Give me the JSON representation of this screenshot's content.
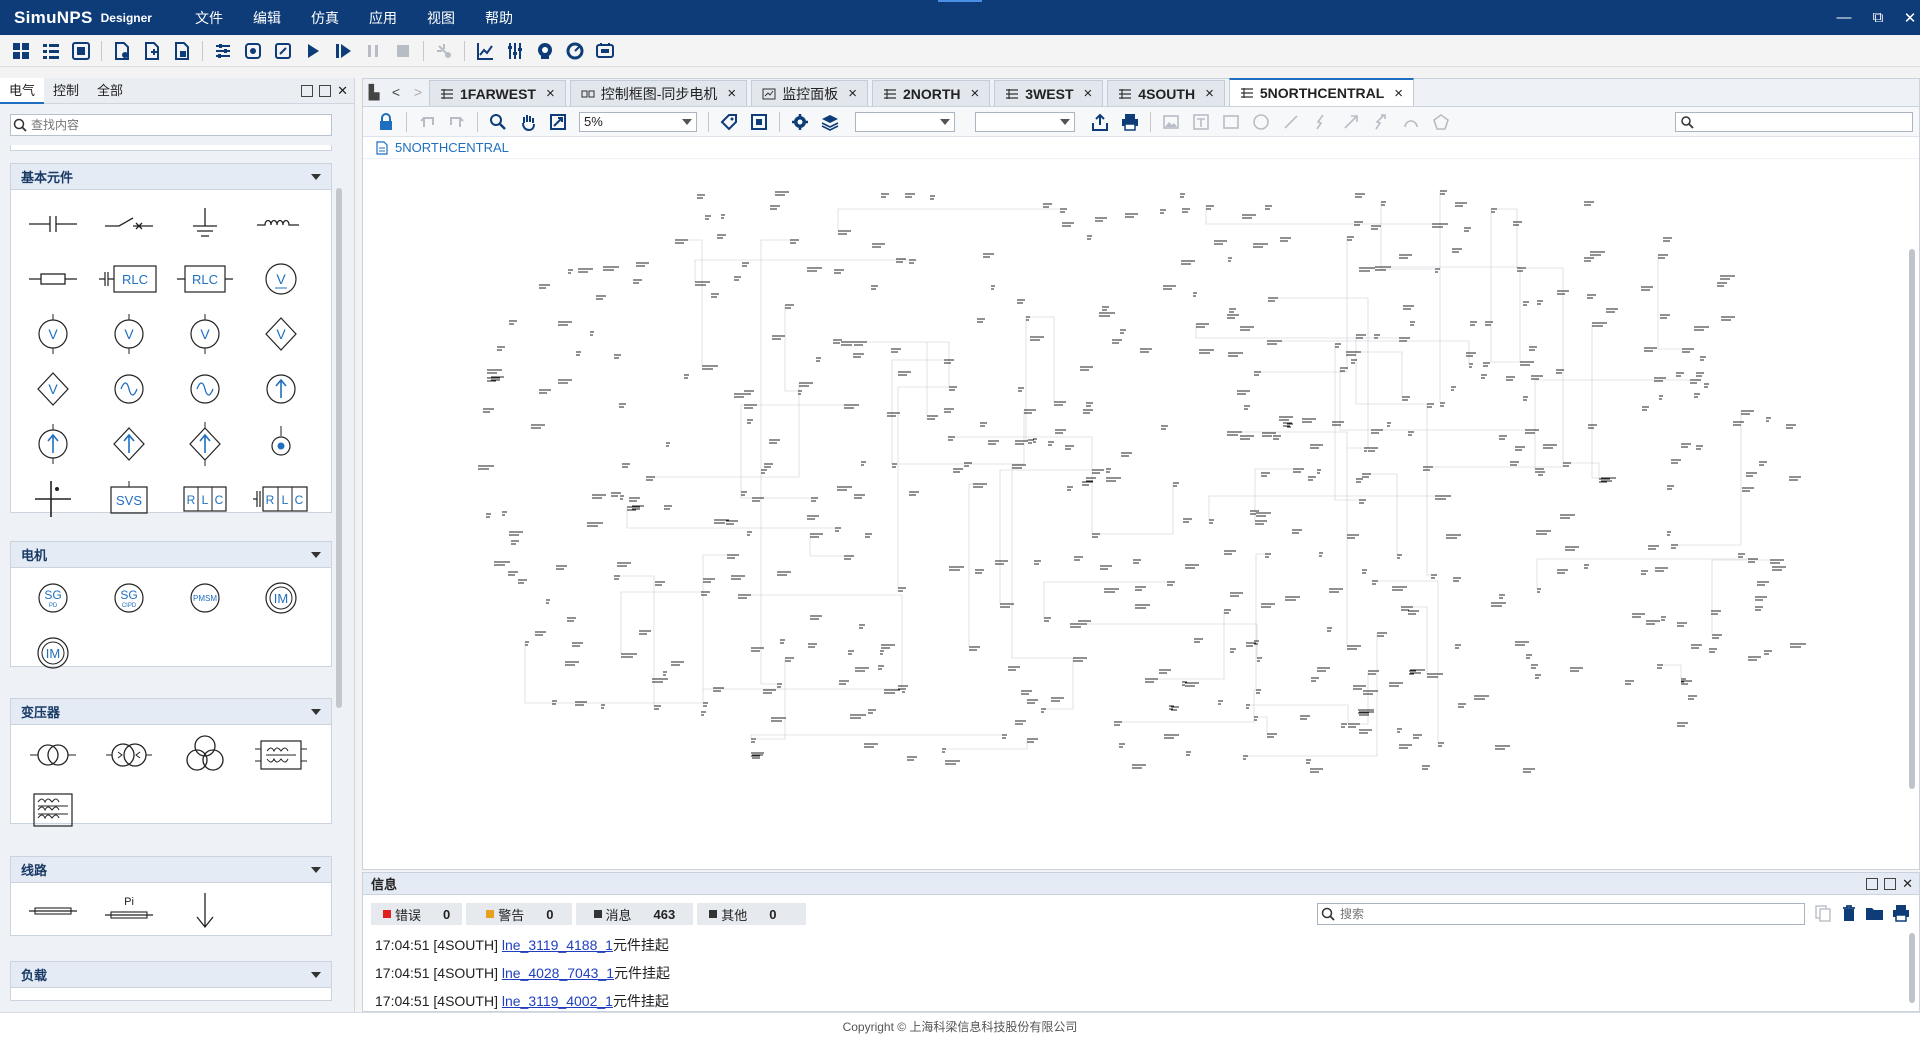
{
  "app": {
    "title": "SimuNPS",
    "subtitle": "Designer"
  },
  "menu": [
    "文件",
    "编辑",
    "仿真",
    "应用",
    "视图",
    "帮助"
  ],
  "window": {
    "minimize": "—",
    "restore": "⧉",
    "close": "✕"
  },
  "left_panel": {
    "tabs": [
      "电气",
      "控制",
      "全部"
    ],
    "search_placeholder": "查找内容",
    "sections": [
      {
        "title": "基本元件",
        "items": [
          "capacitor-icon",
          "switch-icon",
          "ground-icon",
          "inductor-icon",
          "resistor-icon",
          "rlc-branch-icon",
          "rlc-icon",
          "dc-voltage-source-icon",
          "voltage-source-icon",
          "voltage-source-alt-icon",
          "voltage-source-controlled-icon",
          "voltage-source-diamond-icon",
          "voltage-source-diamond-alt-icon",
          "ac-source-icon",
          "ac-source-alt-icon",
          "current-source-icon",
          "current-source-ground-icon",
          "current-source-diamond-icon",
          "current-source-diamond-alt-icon",
          "meter-point-icon",
          "bus-fault-icon",
          "svs-icon",
          "rlc-box-icon",
          "rlc-box-branch-icon"
        ],
        "labels": {
          "rlc": "RLC",
          "svs": "SVS",
          "v": "V"
        }
      },
      {
        "title": "电机",
        "items": [
          "sg-pd-icon",
          "sg-cipd-icon",
          "pmsm-icon",
          "im-icon",
          "im-alt-icon"
        ],
        "labels": {
          "sg": "SG",
          "pd": "PD",
          "cipd": "CIPD",
          "pmsm": "PMSM",
          "im": "IM"
        }
      },
      {
        "title": "变压器",
        "items": [
          "two-winding-transformer-icon",
          "transformer-phase-icon",
          "three-winding-transformer-icon",
          "transformer-box-icon",
          "transformer-box-multi-icon"
        ]
      },
      {
        "title": "线路",
        "items": [
          "line-icon",
          "pi-line-icon",
          "load-arrow-icon"
        ],
        "labels": {
          "pi": "Pi"
        }
      },
      {
        "title": "负载",
        "items": []
      }
    ]
  },
  "doc_tabs": [
    {
      "label": "1FARWEST",
      "icon": "grid-tab-icon",
      "active": false
    },
    {
      "label": "控制框图-同步电机",
      "icon": "control-tab-icon",
      "active": false
    },
    {
      "label": "监控面板",
      "icon": "monitor-tab-icon",
      "active": false
    },
    {
      "label": "2NORTH",
      "icon": "grid-tab-icon",
      "active": false
    },
    {
      "label": "3WEST",
      "icon": "grid-tab-icon",
      "active": false
    },
    {
      "label": "4SOUTH",
      "icon": "grid-tab-icon",
      "active": false
    },
    {
      "label": "5NORTHCENTRAL",
      "icon": "grid-tab-icon",
      "active": true
    }
  ],
  "tab_close": "×",
  "editor": {
    "zoom": "5%",
    "breadcrumb": "5NORTHCENTRAL"
  },
  "info_panel": {
    "title": "信息",
    "counters": [
      {
        "label": "错误",
        "count": "0",
        "color": "#e02020"
      },
      {
        "label": "警告",
        "count": "0",
        "color": "#e8a020"
      },
      {
        "label": "消息",
        "count": "463",
        "color": "#333333"
      },
      {
        "label": "其他",
        "count": "0",
        "color": "#333333"
      }
    ],
    "search_placeholder": "搜索",
    "logs": [
      {
        "time": "17:04:51",
        "source": "[4SOUTH]",
        "link": "lne_3119_4188_1",
        "msg": "元件挂起"
      },
      {
        "time": "17:04:51",
        "source": "[4SOUTH]",
        "link": "lne_4028_7043_1",
        "msg": "元件挂起"
      },
      {
        "time": "17:04:51",
        "source": "[4SOUTH]",
        "link": "lne_3119_4002_1",
        "msg": "元件挂起"
      }
    ]
  },
  "footer": "Copyright © 上海科梁信息科技股份有限公司",
  "colors": {
    "titlebar": "#0e3c78",
    "accent": "#1f6fbf",
    "icon": "#1f6fbf"
  }
}
